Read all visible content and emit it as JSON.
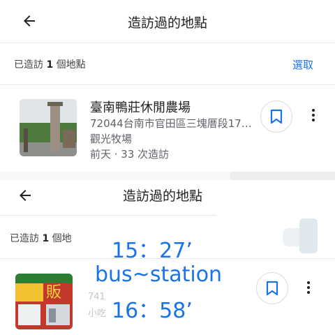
{
  "header": {
    "title": "造訪過的地點"
  },
  "summary": {
    "prefix": "已造訪 ",
    "count": "1",
    "suffix": " 個地點",
    "select_label": "選取"
  },
  "place": {
    "name": "臺南鴨莊休閒農場",
    "address": "72044台南市官田區三塊厝段17…",
    "category": "觀光牧場",
    "visits": "前天 · 33 次造訪"
  },
  "bottom_header": {
    "title": "造訪過的地點"
  },
  "bottom_summary": {
    "prefix": "已造訪 ",
    "count": "1",
    "suffix": " 個地"
  },
  "overlay": {
    "line1": "15：27’",
    "line2": "bus~station",
    "line3": "16：58’"
  },
  "bottom_place_fragments": {
    "address_fragment": "741",
    "category_fragment": "小吃"
  },
  "icons": {
    "back": "arrow-left-icon",
    "bookmark": "bookmark-icon",
    "more": "more-vert-icon"
  },
  "colors": {
    "accent": "#1a73e8",
    "text": "#202124",
    "secondary": "#5f6368"
  }
}
